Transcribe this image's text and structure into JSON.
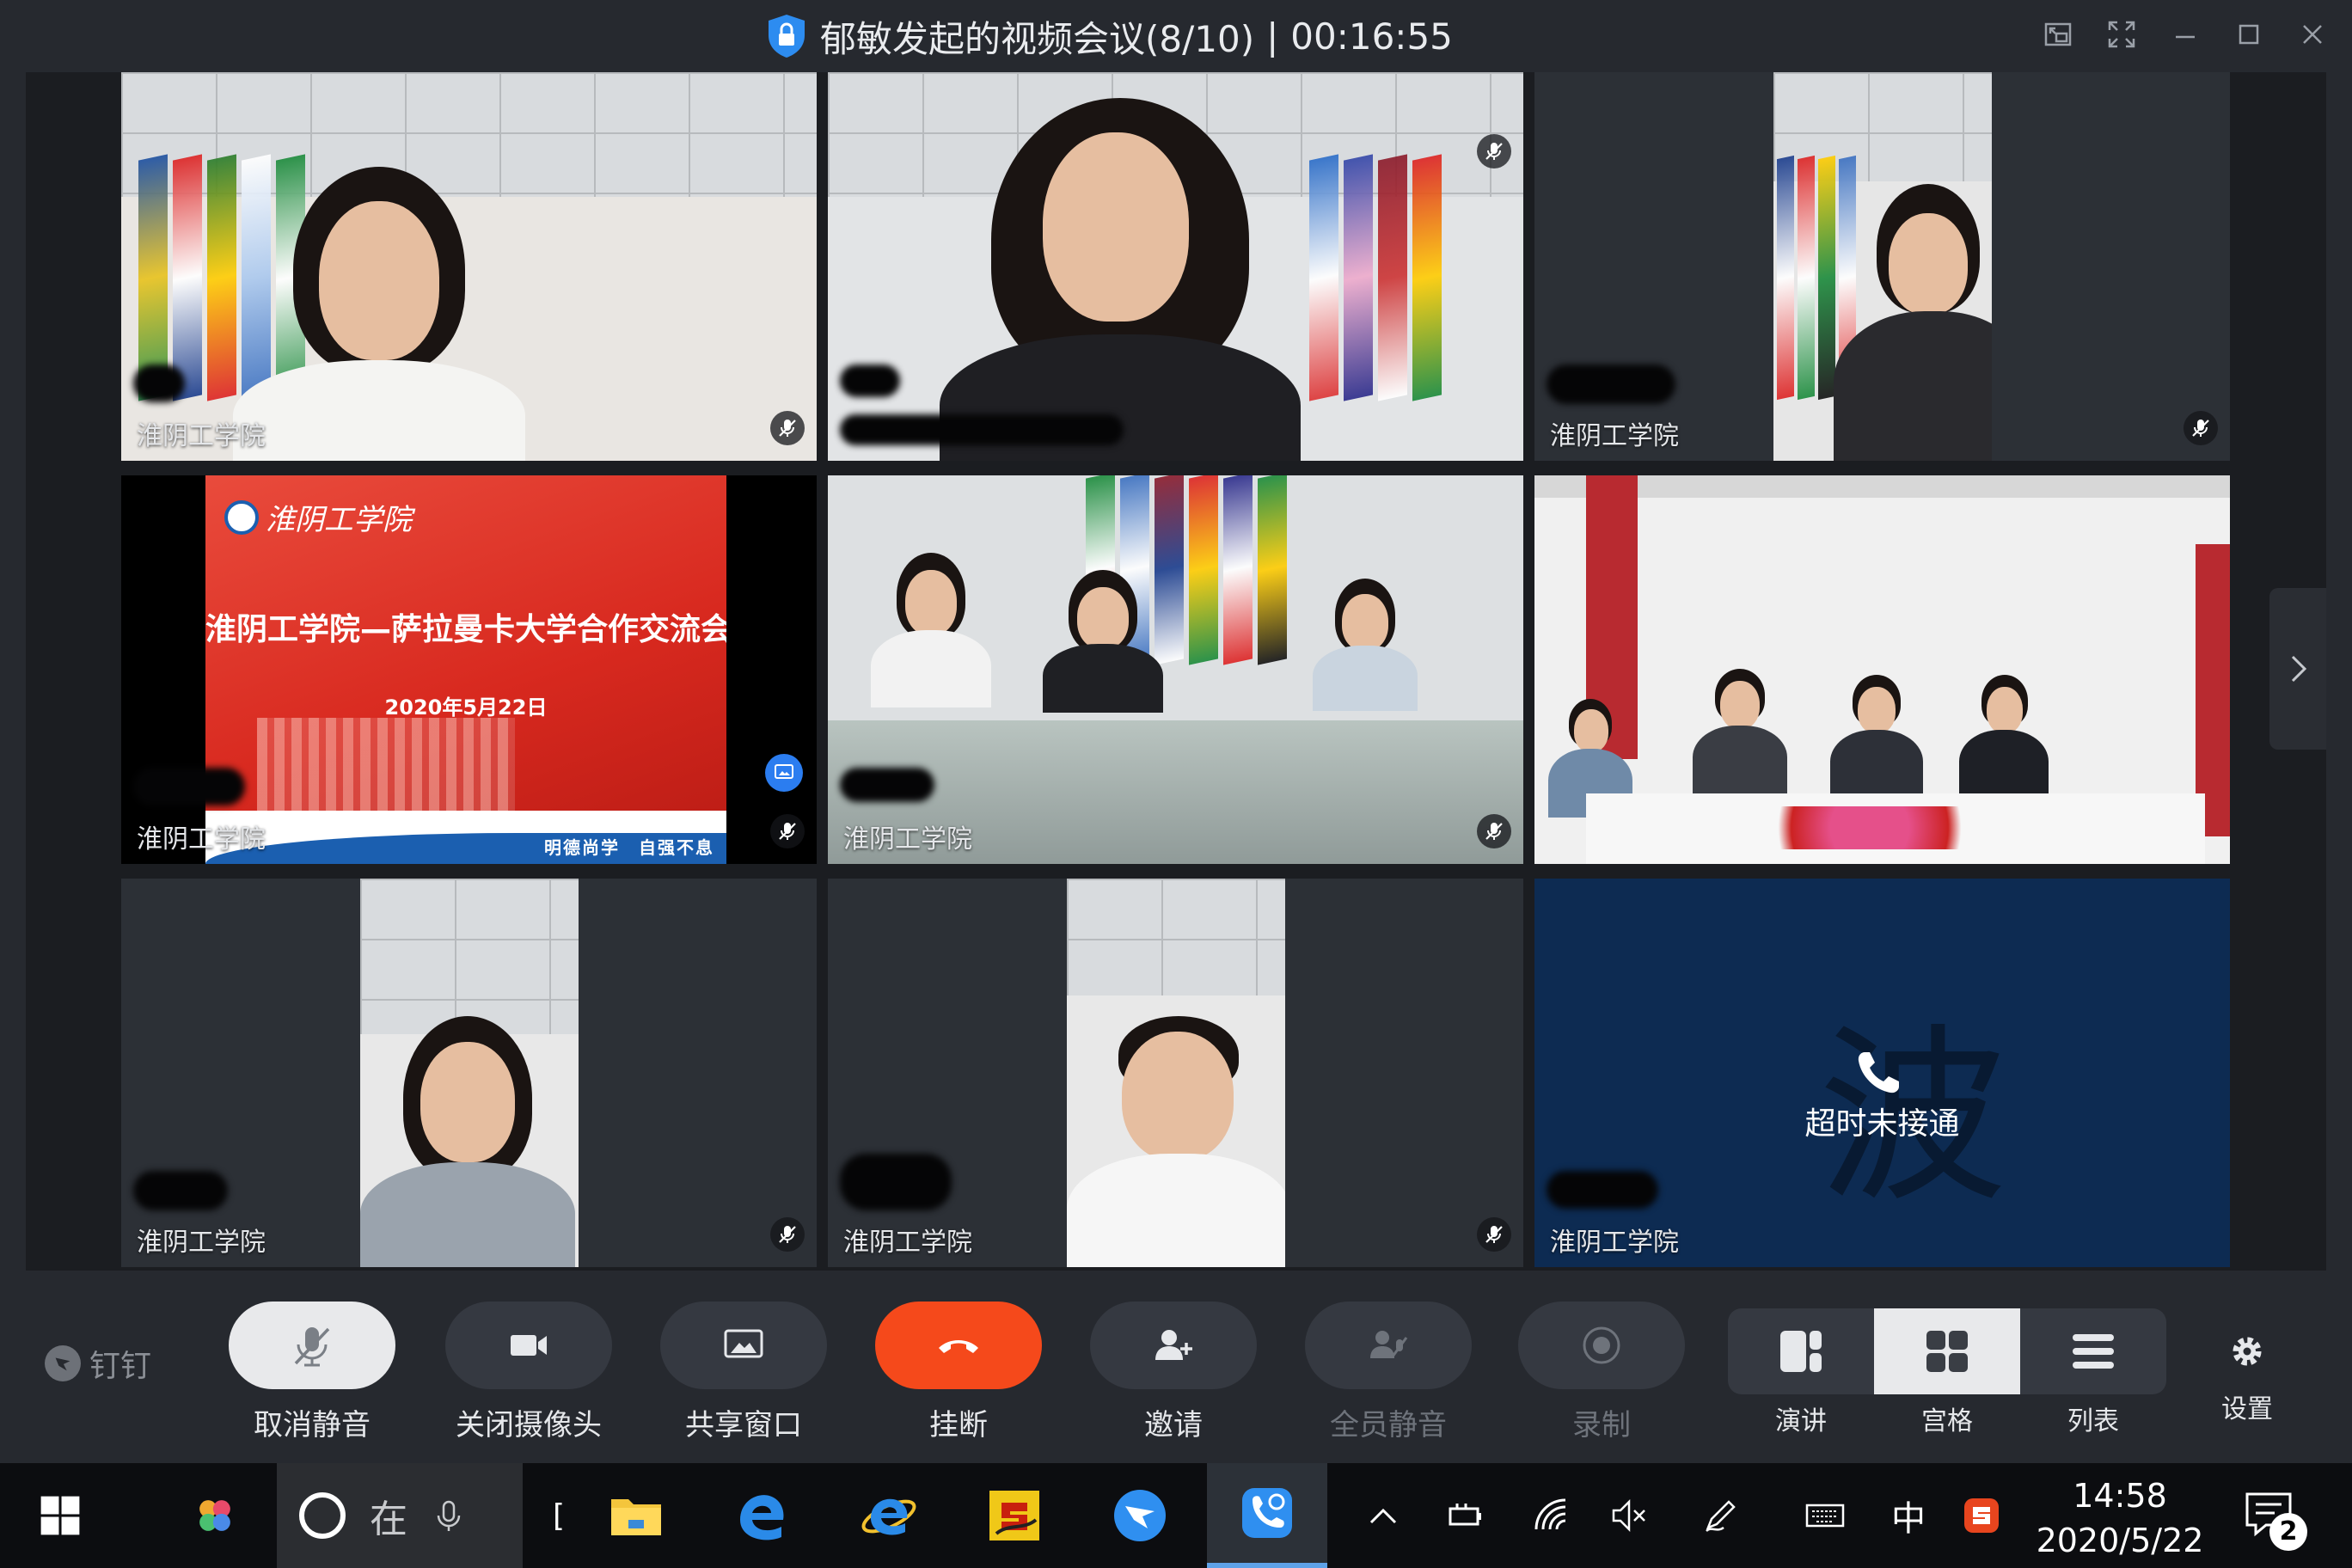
{
  "window": {
    "title": "郁敏发起的视频会议(8/10)",
    "separator": "|",
    "timer": "00:16:55"
  },
  "tiles": [
    {
      "label": "淮阴工学院",
      "muted": true
    },
    {
      "label": "",
      "muted": true
    },
    {
      "label": "淮阴工学院",
      "muted": true
    },
    {
      "label": "淮阴工学院",
      "muted": true,
      "sharing": true
    },
    {
      "label": "淮阴工学院",
      "muted": true
    },
    {
      "label": "",
      "muted": false
    },
    {
      "label": "淮阴工学院",
      "muted": true
    },
    {
      "label": "淮阴工学院",
      "muted": true
    },
    {
      "label": "淮阴工学院",
      "avatar_char": "波",
      "status": "超时未接通"
    }
  ],
  "slide": {
    "logo": "淮阴工学院",
    "title": "淮阴工学院—萨拉曼卡大学合作交流会",
    "date": "2020年5月22日",
    "motto": "明德尚学　自强不息"
  },
  "toolbar": {
    "brand": "钉钉",
    "unmute": "取消静音",
    "camera_off": "关闭摄像头",
    "share": "共享窗口",
    "hangup": "挂断",
    "invite": "邀请",
    "mute_all": "全员静音",
    "record": "录制",
    "layout_speech": "演讲",
    "layout_grid": "宫格",
    "layout_list": "列表",
    "settings": "设置"
  },
  "taskbar": {
    "search_char": "在",
    "bracket": "[",
    "ime": "中",
    "time": "14:58",
    "date": "2020/5/22",
    "notifications": "2"
  },
  "colors": {
    "window_bg": "#26292f",
    "hangup": "#f5491b",
    "timeout_tile": "#0d2b52",
    "slide_red": "#d8291f",
    "share_badge": "#2b7df0"
  }
}
